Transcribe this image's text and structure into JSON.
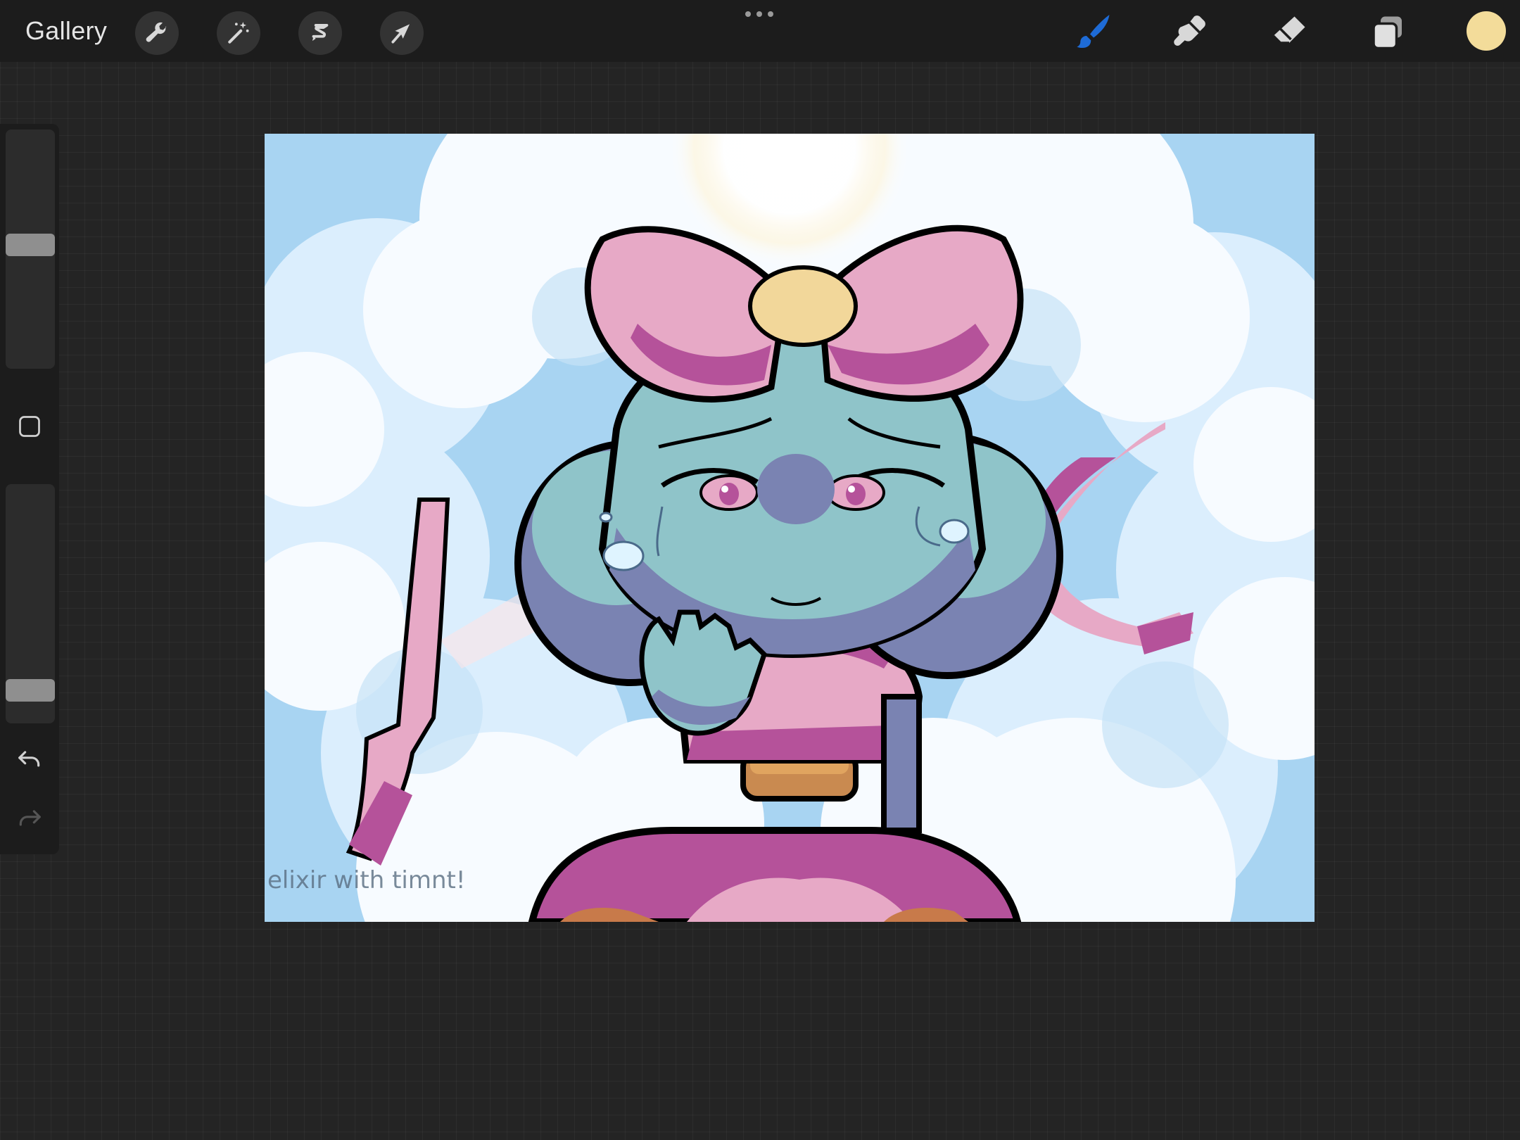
{
  "toolbar": {
    "gallery_label": "Gallery",
    "left_tools": [
      "wrench-icon",
      "magic-wand-icon",
      "selection-icon",
      "transform-arrow-icon"
    ],
    "right_tools": [
      "brush-icon",
      "smudge-icon",
      "eraser-icon",
      "layers-icon"
    ],
    "active_tool": "brush",
    "active_tool_color": "#1e6bd6",
    "current_color": "#f3dc9a"
  },
  "sidebar": {
    "brush_size_level": 0.52,
    "opacity_level": 0.1,
    "controls": [
      "modify-square-icon",
      "undo-icon",
      "redo-icon"
    ]
  },
  "canvas": {
    "artwork_colors": {
      "sky": "#a8d4f2",
      "cloud": "#f7fbff",
      "bow": "#e7a9c6",
      "bow_shadow": "#b5529a",
      "skin": "#8fc4c9",
      "shade": "#7a83b2",
      "gold": "#f2d79a",
      "outline": "#000000"
    },
    "signature": "elixir with timnt!"
  }
}
